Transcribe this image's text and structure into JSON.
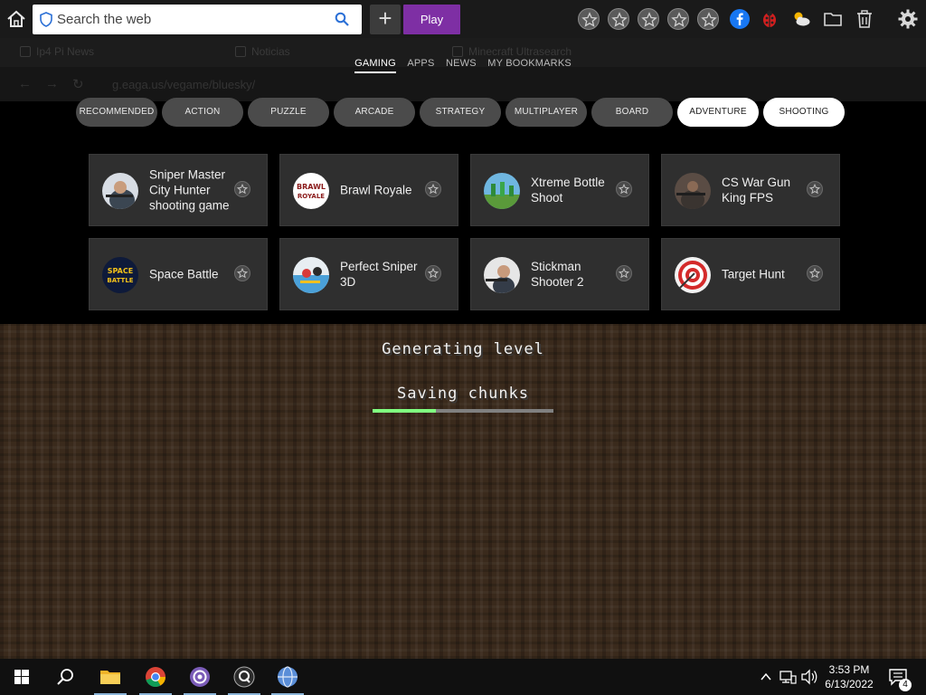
{
  "toolbar": {
    "search_placeholder": "Search the web",
    "play_label": "Play",
    "bookmark_star_count": 5
  },
  "ghost_browser": {
    "tabs": [
      "Ip4 Pi News",
      "Noticias",
      "Minecraft Ultrasearch"
    ],
    "url": "g.eaga.us/vegame/bluesky/"
  },
  "overlay_nav": {
    "items": [
      {
        "label": "GAMING",
        "active": true
      },
      {
        "label": "APPS",
        "active": false
      },
      {
        "label": "NEWS",
        "active": false
      },
      {
        "label": "MY BOOKMARKS",
        "active": false
      }
    ]
  },
  "categories": [
    {
      "label": "RECOMMENDED",
      "style": "dark"
    },
    {
      "label": "ACTION",
      "style": "dark"
    },
    {
      "label": "PUZZLE",
      "style": "dark"
    },
    {
      "label": "ARCADE",
      "style": "dark"
    },
    {
      "label": "STRATEGY",
      "style": "dark"
    },
    {
      "label": "MULTIPLAYER",
      "style": "dark"
    },
    {
      "label": "BOARD",
      "style": "dark"
    },
    {
      "label": "ADVENTURE",
      "style": "light"
    },
    {
      "label": "SHOOTING",
      "style": "light"
    }
  ],
  "games": [
    {
      "title": "Sniper Master City Hunter shooting game",
      "thumb": "sniper-thumb"
    },
    {
      "title": "Brawl Royale",
      "thumb": "brawl-royale-thumb"
    },
    {
      "title": "Xtreme Bottle Shoot",
      "thumb": "bottle-shoot-thumb"
    },
    {
      "title": "CS War Gun King FPS",
      "thumb": "cs-war-thumb"
    },
    {
      "title": "Space Battle",
      "thumb": "space-battle-thumb"
    },
    {
      "title": "Perfect Sniper 3D",
      "thumb": "perfect-sniper-thumb"
    },
    {
      "title": "Stickman Shooter 2",
      "thumb": "stickman-thumb"
    },
    {
      "title": "Target Hunt",
      "thumb": "target-hunt-thumb"
    }
  ],
  "game_loading": {
    "title": "Generating level",
    "status": "Saving chunks",
    "progress": 0.35
  },
  "taskbar": {
    "apps": [
      "start",
      "search",
      "file-explorer",
      "chrome",
      "app-circle",
      "app-q",
      "app-globe"
    ],
    "clock_time": "3:53 PM",
    "clock_date": "6/13/2022",
    "notification_count": "4"
  },
  "colors": {
    "play_purple": "#7e2fa4",
    "progress_green": "#80ff80",
    "card_bg": "#2f2f2f",
    "pill_dark": "#4b4b4b"
  }
}
